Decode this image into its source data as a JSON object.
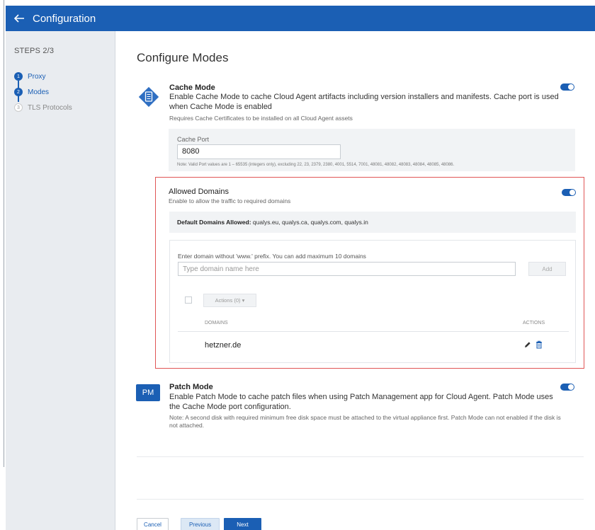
{
  "header": {
    "title": "Configuration"
  },
  "sidebar": {
    "steps_label": "STEPS 2/3",
    "items": [
      {
        "num": "1",
        "label": "Proxy"
      },
      {
        "num": "2",
        "label": "Modes"
      },
      {
        "num": "3",
        "label": "TLS Protocols"
      }
    ]
  },
  "main": {
    "title": "Configure Modes",
    "cache_mode": {
      "title": "Cache Mode",
      "description": "Enable Cache Mode to cache Cloud Agent artifacts including version installers and manifests. Cache port is used when Cache Mode is enabled",
      "requirement": "Requires Cache Certificates to be installed on all Cloud Agent assets",
      "port_label": "Cache Port",
      "port_value": "8080",
      "port_note": "Note: Valid Port values are 1 – 65535 (integers only), excluding 22, 23, 2379, 2380, 4001, 5514, 7001, 48081, 48082, 48083, 48084, 48085, 48086."
    },
    "allowed_domains": {
      "title": "Allowed Domains",
      "description": "Enable to allow the traffic to required domains",
      "default_label": "Default Domains Allowed:",
      "default_value": " qualys.eu, qualys.ca, qualys.com, qualys.in",
      "hint": "Enter domain without 'www.' prefix. You can add maximum 10 domains",
      "placeholder": "Type domain name here",
      "add_label": "Add",
      "actions_label": "Actions (0)  ▾",
      "col_domains": "DOMAINS",
      "col_actions": "ACTIONS",
      "rows": [
        {
          "domain": "hetzner.de"
        }
      ]
    },
    "patch_mode": {
      "badge": "PM",
      "title": "Patch Mode",
      "description": "Enable Patch Mode to cache patch files when using Patch Management app for Cloud Agent. Patch Mode uses the Cache Mode port configuration.",
      "note": "Note: A second disk with required minimum free disk space must be attached to the virtual appliance first. Patch Mode can not enabled if the disk is not attached."
    }
  },
  "footer": {
    "cancel": "Cancel",
    "previous": "Previous",
    "next": "Next"
  },
  "colors": {
    "accent": "#1b5fb4",
    "highlight_border": "#e05555"
  }
}
